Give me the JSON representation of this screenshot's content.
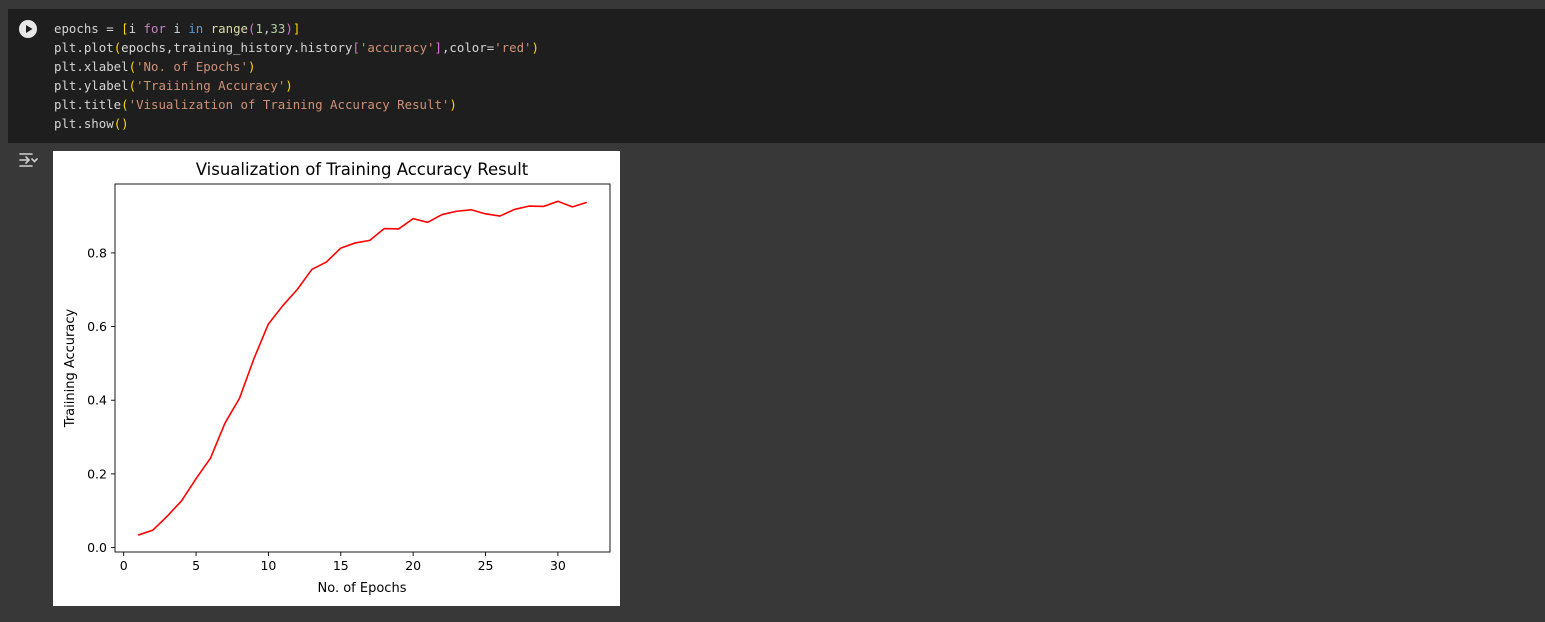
{
  "cell": {
    "code_lines": [
      "epochs = [i for i in range(1,33)]",
      "plt.plot(epochs,training_history.history['accuracy'],color='red')",
      "plt.xlabel('No. of Epochs')",
      "plt.ylabel('Traiining Accuracy')",
      "plt.title('Visualization of Training Accuracy Result')",
      "plt.show()"
    ]
  },
  "icons": {
    "run": "play-icon",
    "output": "output-toggle-icon"
  },
  "colors": {
    "page_bg": "#383838",
    "cell_bg": "#1e1e1e",
    "line": "#ff0000"
  },
  "chart_data": {
    "type": "line",
    "title": "Visualization of Training Accuracy Result",
    "xlabel": "No. of Epochs",
    "ylabel": "Traiining Accuracy",
    "xlim": [
      -0.6,
      33.6
    ],
    "ylim": [
      -0.012,
      0.987
    ],
    "xticks": [
      0,
      5,
      10,
      15,
      20,
      25,
      30
    ],
    "xtick_labels": [
      "0",
      "5",
      "10",
      "15",
      "20",
      "25",
      "30"
    ],
    "yticks": [
      0.0,
      0.2,
      0.4,
      0.6,
      0.8
    ],
    "ytick_labels": [
      "0.0",
      "0.2",
      "0.4",
      "0.6",
      "0.8"
    ],
    "grid": false,
    "series": [
      {
        "color": "#ff0000",
        "x": [
          1,
          2,
          3,
          4,
          5,
          6,
          7,
          8,
          9,
          10,
          11,
          12,
          13,
          14,
          15,
          16,
          17,
          18,
          19,
          20,
          21,
          22,
          23,
          24,
          25,
          26,
          27,
          28,
          29,
          30,
          31,
          32
        ],
        "y": [
          0.034,
          0.047,
          0.085,
          0.127,
          0.187,
          0.243,
          0.338,
          0.405,
          0.513,
          0.607,
          0.657,
          0.701,
          0.755,
          0.775,
          0.813,
          0.827,
          0.834,
          0.866,
          0.865,
          0.893,
          0.883,
          0.904,
          0.913,
          0.917,
          0.906,
          0.9,
          0.918,
          0.927,
          0.926,
          0.94,
          0.925,
          0.937
        ]
      }
    ]
  }
}
